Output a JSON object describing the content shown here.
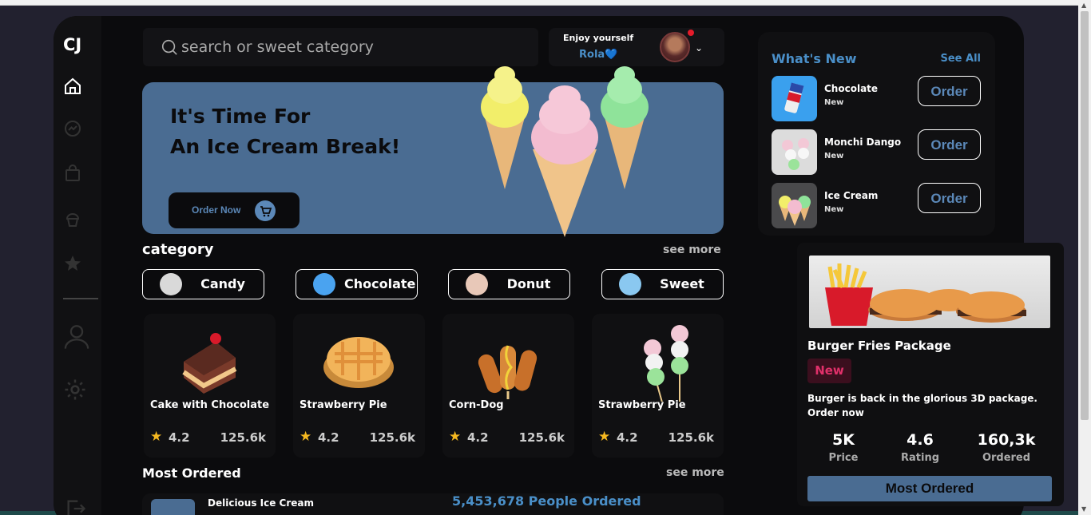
{
  "brand": {
    "logo": "CJ"
  },
  "search": {
    "placeholder": "search or sweet category"
  },
  "user": {
    "greeting": "Enjoy yourself",
    "name": "Rola💙"
  },
  "hero": {
    "title_line1": "It's Time For",
    "title_line2": "An Ice Cream Break!",
    "button_label": "Order Now"
  },
  "category": {
    "heading": "category",
    "see_more": "see more",
    "items": [
      {
        "label": "Candy",
        "icon": "candy-icon"
      },
      {
        "label": "Chocolate",
        "icon": "chocolate-icon"
      },
      {
        "label": "Donut",
        "icon": "donut-icon"
      },
      {
        "label": "Sweet",
        "icon": "sweet-icon"
      }
    ]
  },
  "products": [
    {
      "name": "Cake with Chocolate",
      "rating": "4.2",
      "count": "125.6k"
    },
    {
      "name": "Strawberry Pie",
      "rating": "4.2",
      "count": "125.6k"
    },
    {
      "name": "Corn-Dog",
      "rating": "4.2",
      "count": "125.6k"
    },
    {
      "name": "Strawberry Pie",
      "rating": "4.2",
      "count": "125.6k"
    }
  ],
  "most_ordered": {
    "heading": "Most Ordered",
    "see_more": "see more",
    "item_name": "Delicious Ice Cream",
    "people_ordered": "5,453,678 People Ordered"
  },
  "whats_new": {
    "title": "What's New",
    "see_all": "See All",
    "items": [
      {
        "name": "Chocolate",
        "tag": "New",
        "button": "Order"
      },
      {
        "name": "Monchi Dango",
        "tag": "New",
        "button": "Order"
      },
      {
        "name": "Ice Cream",
        "tag": "New",
        "button": "Order"
      }
    ]
  },
  "promo": {
    "title": "Burger Fries Package",
    "badge": "New",
    "description": "Burger is back in the glorious 3D package. Order now",
    "stats": [
      {
        "value": "5K",
        "label": "Price"
      },
      {
        "value": "4.6",
        "label": "Rating"
      },
      {
        "value": "160,3k",
        "label": "Ordered"
      }
    ],
    "button": "Most Ordered"
  },
  "colors": {
    "accent_blue": "#4a6c92",
    "link_blue": "#4a8fc8",
    "badge_pink": "#e0306a",
    "star_gold": "#f5b820"
  }
}
